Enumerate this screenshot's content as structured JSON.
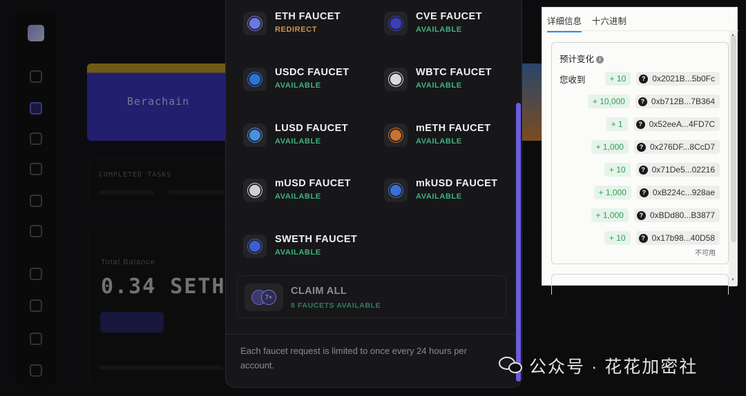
{
  "faucets": [
    {
      "name": "ETH FAUCET",
      "status": "REDIRECT",
      "icon": "eth-icon",
      "color": "#6d79e0"
    },
    {
      "name": "CVE FAUCET",
      "status": "AVAILABLE",
      "icon": "cve-icon",
      "color": "#3b3fb5"
    },
    {
      "name": "USDC FAUCET",
      "status": "AVAILABLE",
      "icon": "usdc-icon",
      "color": "#2d73d6"
    },
    {
      "name": "WBTC FAUCET",
      "status": "AVAILABLE",
      "icon": "wbtc-icon",
      "color": "#d9d9d9"
    },
    {
      "name": "LUSD FAUCET",
      "status": "AVAILABLE",
      "icon": "lusd-icon",
      "color": "#4a8fe0"
    },
    {
      "name": "mETH FAUCET",
      "status": "AVAILABLE",
      "icon": "meth-icon",
      "color": "#c7742f"
    },
    {
      "name": "mUSD FAUCET",
      "status": "AVAILABLE",
      "icon": "musd-icon",
      "color": "#cfcfcf"
    },
    {
      "name": "mkUSD FAUCET",
      "status": "AVAILABLE",
      "icon": "mkusd-icon",
      "color": "#3b6fd8"
    },
    {
      "name": "SWETH FAUCET",
      "status": "AVAILABLE",
      "icon": "sweth-icon",
      "color": "#3a5fd0"
    }
  ],
  "claim_all": {
    "title": "CLAIM ALL",
    "subtitle": "8 FAUCETS AVAILABLE"
  },
  "footer_note": "Each faucet request is limited to once every 24 hours per account.",
  "wallet": {
    "tabs": [
      "详细信息",
      "十六进制"
    ],
    "panel_title": "预计变化",
    "receive_label": "您收到",
    "rows": [
      {
        "amount": "+ 10",
        "address": "0x2021B...5b0Fc"
      },
      {
        "amount": "+ 10,000",
        "address": "0xb712B...7B364"
      },
      {
        "amount": "+ 1",
        "address": "0x52eeA...4FD7C"
      },
      {
        "amount": "+ 1,000",
        "address": "0x276DF...8CcD7"
      },
      {
        "amount": "+ 10",
        "address": "0x71De5...02216"
      },
      {
        "amount": "+ 1,000",
        "address": "0xB224c...928ae"
      },
      {
        "amount": "+ 1,000",
        "address": "0xBDd80...B3877"
      },
      {
        "amount": "+ 10",
        "address": "0x17b98...40D58"
      }
    ],
    "unavailable": "不可用"
  },
  "watermark": "公众号 · 花花加密社",
  "background": {
    "banner_text": "Berachain",
    "completed_label": "COMPLETED TASKS",
    "balance_label": "Total Balance",
    "balance_value": "0.34 SETH"
  },
  "colors": {
    "available": "#3fb27f",
    "redirect": "#d4914a",
    "accent": "#6a5be0"
  }
}
